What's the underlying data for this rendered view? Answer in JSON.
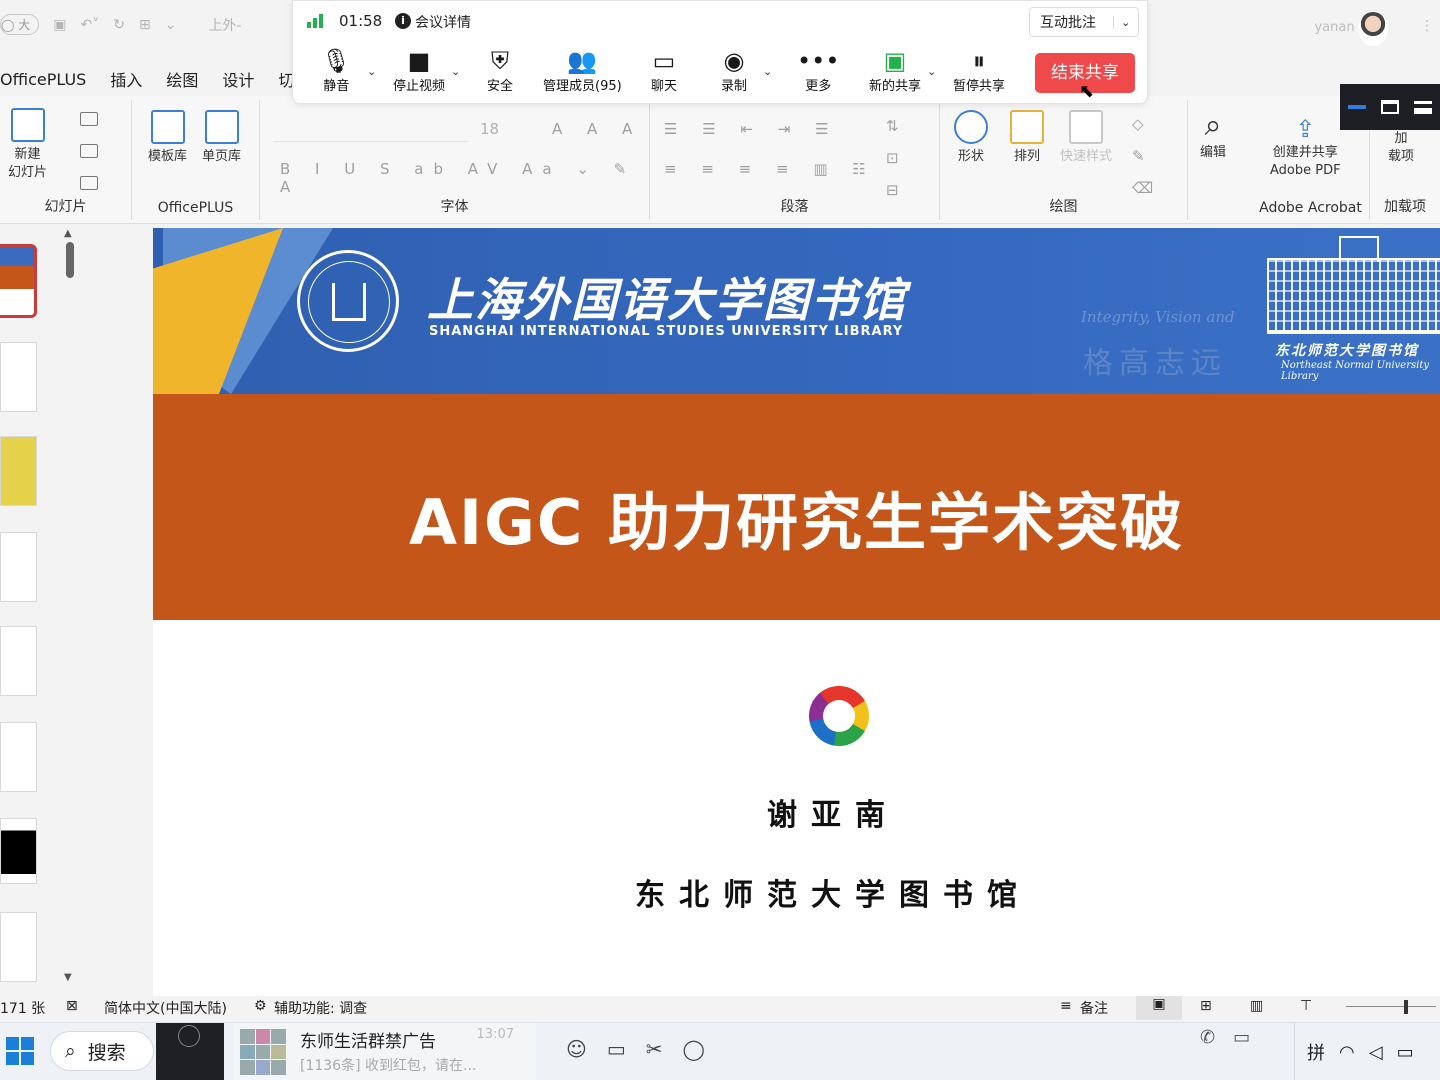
{
  "titlebar": {
    "doc_title_fragment": "上外-",
    "qat_pill": "大",
    "user_name": "yanan xie",
    "more_dots": "⋮"
  },
  "ribbon_tabs": [
    "OfficePLUS",
    "插入",
    "绘图",
    "设计",
    "切"
  ],
  "ribbon": {
    "new_slide": "新建\n幻灯片",
    "group_slides": "幻灯片",
    "template_lib": "模板库",
    "single_page_lib": "单页库",
    "group_officeplus": "OfficePLUS",
    "font_size": "18",
    "group_font": "字体",
    "group_paragraph": "段落",
    "shape": "形状",
    "arrange": "排列",
    "quick_style": "快速样式",
    "group_drawing": "绘图",
    "edit": "编辑",
    "create_share_pdf": "创建并共享\nAdobe PDF",
    "group_acrobat": "Adobe Acrobat",
    "addins": "加\n载项",
    "group_addins": "加载项"
  },
  "meeting": {
    "duration": "01:58",
    "info_label": "会议详情",
    "annotate_label": "互动批注",
    "buttons": [
      {
        "label": "静音",
        "icon": "microphone-icon"
      },
      {
        "label": "停止视频",
        "icon": "video-camera-icon"
      },
      {
        "label": "安全",
        "icon": "shield-icon"
      },
      {
        "label": "管理成员(95)",
        "icon": "members-icon"
      },
      {
        "label": "聊天",
        "icon": "chat-icon"
      },
      {
        "label": "录制",
        "icon": "record-icon"
      },
      {
        "label": "更多",
        "icon": "more-icon"
      },
      {
        "label": "新的共享",
        "icon": "new-share-icon"
      },
      {
        "label": "暂停共享",
        "icon": "pause-share-icon"
      }
    ],
    "end_share": "结束共享"
  },
  "slide": {
    "library_cn": "上海外国语大学图书馆",
    "library_en": "SHANGHAI INTERNATIONAL STUDIES UNIVERSITY LIBRARY",
    "motto_en": "Integrity, Vision and",
    "motto_cn": "格高志远",
    "nenu_cn": "东北师范大学图书馆",
    "nenu_en": "Northeast Normal University Library",
    "title": "AIGC 助力研究生学术突破",
    "author": "谢亚南",
    "organization": "东北师范大学图书馆"
  },
  "statusbar": {
    "slide_count": "171 张",
    "language": "简体中文(中国大陆)",
    "accessibility": "辅助功能: 调查",
    "notes": "备注"
  },
  "taskbar": {
    "search": "搜索",
    "chat_name": "东师生活群禁广告",
    "chat_time": "13:07",
    "chat_msg": "[1136条] 收到红包，请在...",
    "ime": "拼"
  },
  "colors": {
    "banner_blue": "#3366bb",
    "slide_orange": "#c4561a",
    "end_share_red": "#f0494b",
    "signal_green": "#22b14c"
  }
}
